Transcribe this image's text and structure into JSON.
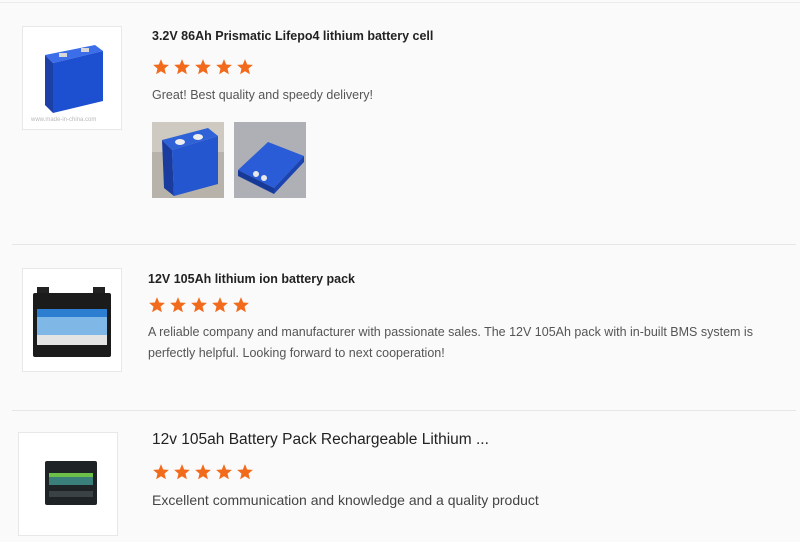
{
  "reviews": [
    {
      "title": "3.2V 86Ah Prismatic Lifepo4 lithium battery cell",
      "rating": 5,
      "comment": "Great! Best quality and speedy delivery!",
      "photo_count": 2,
      "thumb_caption": "www.made-in-china.com"
    },
    {
      "title": "12V 105Ah lithium ion battery pack",
      "rating": 5,
      "comment": "A reliable company and manufacturer with passionate sales. The 12V 105Ah pack with in-built BMS system is perfectly helpful. Looking forward to next cooperation!"
    },
    {
      "title": "12v 105ah Battery Pack Rechargeable Lithium ...",
      "rating": 5,
      "comment": "Excellent communication and knowledge and a quality product"
    }
  ],
  "colors": {
    "star": "#f26b1d",
    "cell_blue": "#1d4fd1",
    "pack_black": "#1b1b1b"
  },
  "icons": {
    "rating": "star-icon"
  }
}
